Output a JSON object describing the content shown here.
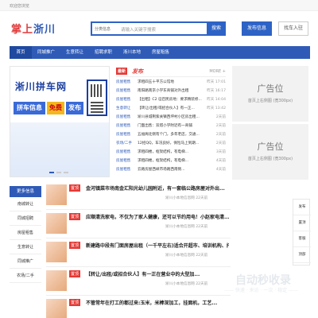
{
  "top": {
    "notice": "欢迎您浏览"
  },
  "brand": {
    "part1": "掌上",
    "part2": "浙川"
  },
  "search": {
    "scope": "分类信息",
    "placeholder": "请输入关键字搜索",
    "button": "搜索"
  },
  "header_buttons": {
    "post": "发布信息",
    "find": "找车入驻"
  },
  "nav": {
    "items": [
      "首页",
      "同城推广",
      "生意转让",
      "招聘求职",
      "淅川本地",
      "房屋租售"
    ]
  },
  "banner": {
    "city": "淅川拼车网",
    "tag1": "拼车信息",
    "tag2": "免费",
    "tag3": "发布"
  },
  "news": {
    "header_badge": "最新",
    "header_title": "发布",
    "more": "MORE +",
    "rows": [
      {
        "cat": "房屋租售",
        "title": "求租四五十平方公馆地",
        "time": "昨天 17:01"
      },
      {
        "cat": "房屋租售",
        "title": "南阳路南京小学东商铺对外出租",
        "time": "昨天 16:17"
      },
      {
        "cat": "房屋租售",
        "title": "【出租】C2 征召民房地：要求精装修...",
        "time": "昨天 14:04"
      },
      {
        "cat": "生意转让",
        "title": "【转让/出租/或招合伙人】有一正...",
        "time": "昨天 13:42"
      },
      {
        "cat": "房屋租售",
        "title": "淅川县城荆紫关镇西坪村小区房出租...",
        "time": "2天前"
      },
      {
        "cat": "房屋租售",
        "title": "门面出售：双塔小学附近有一商铺",
        "time": "2天前"
      },
      {
        "cat": "房屋租售",
        "title": "五福阁北侧有个门，多年老店，交通...",
        "time": "2天前"
      },
      {
        "cat": "农场/二手",
        "title": "12招QQ，车况良好，保险马上到期...",
        "time": "2天前"
      },
      {
        "cat": "房屋租售",
        "title": "求租四楼，框架结构，有电梯...",
        "time": "3天前"
      },
      {
        "cat": "房屋租售",
        "title": "求租四楼，框架结构，有电梯...",
        "time": "4天前"
      },
      {
        "cat": "房屋租售",
        "title": "云路房屋西峡市场路西南侧...",
        "time": "4天前"
      }
    ]
  },
  "ads": [
    {
      "big": "广告位",
      "small": "首页上右侧图 (宽300px)"
    },
    {
      "big": "广告位",
      "small": "首页上右侧图 (宽300px)"
    }
  ],
  "side": {
    "header": "更多信息",
    "items": [
      "南城转让",
      "同城招聘",
      "房屋租售",
      "生意转让",
      "同城推广",
      "农场/二手"
    ]
  },
  "cards": [
    {
      "badge": "置顶",
      "title": "金河镇菜市场南金汇阳光幼儿园附近，有一套临公路房屋对外出...",
      "meta": "淅川小本地信息网 22天前"
    },
    {
      "badge": "置顶",
      "title": "应顺清洗家电，不仅为了家人健康，还可以节约用电！小赵家电清...",
      "meta": "淅川小本地信息网 22天前"
    },
    {
      "badge": "置顶",
      "title": "新建路中段有门面房屋出租（一千平左右)适合开超市、培训机构、托...",
      "meta": "淅川小本地信息网 22天前"
    },
    {
      "badge": "置顶",
      "title": "【转让/出租/或招合伙人】有一正在营业中的大型加...",
      "meta": "淅川小本地信息网 22天前"
    },
    {
      "badge": "置顶",
      "title": "不管常年在打工的都过来:玉米，米棒深加工，挂面机，工艺..."
    }
  ],
  "rightwidget": {
    "items": [
      "发布",
      "置顶",
      "客服",
      "顶部"
    ]
  },
  "watermark": {
    "line1": "自动秒收录",
    "line2": "—— 快速 · 来访 · 一次 · 稳定 ——"
  }
}
